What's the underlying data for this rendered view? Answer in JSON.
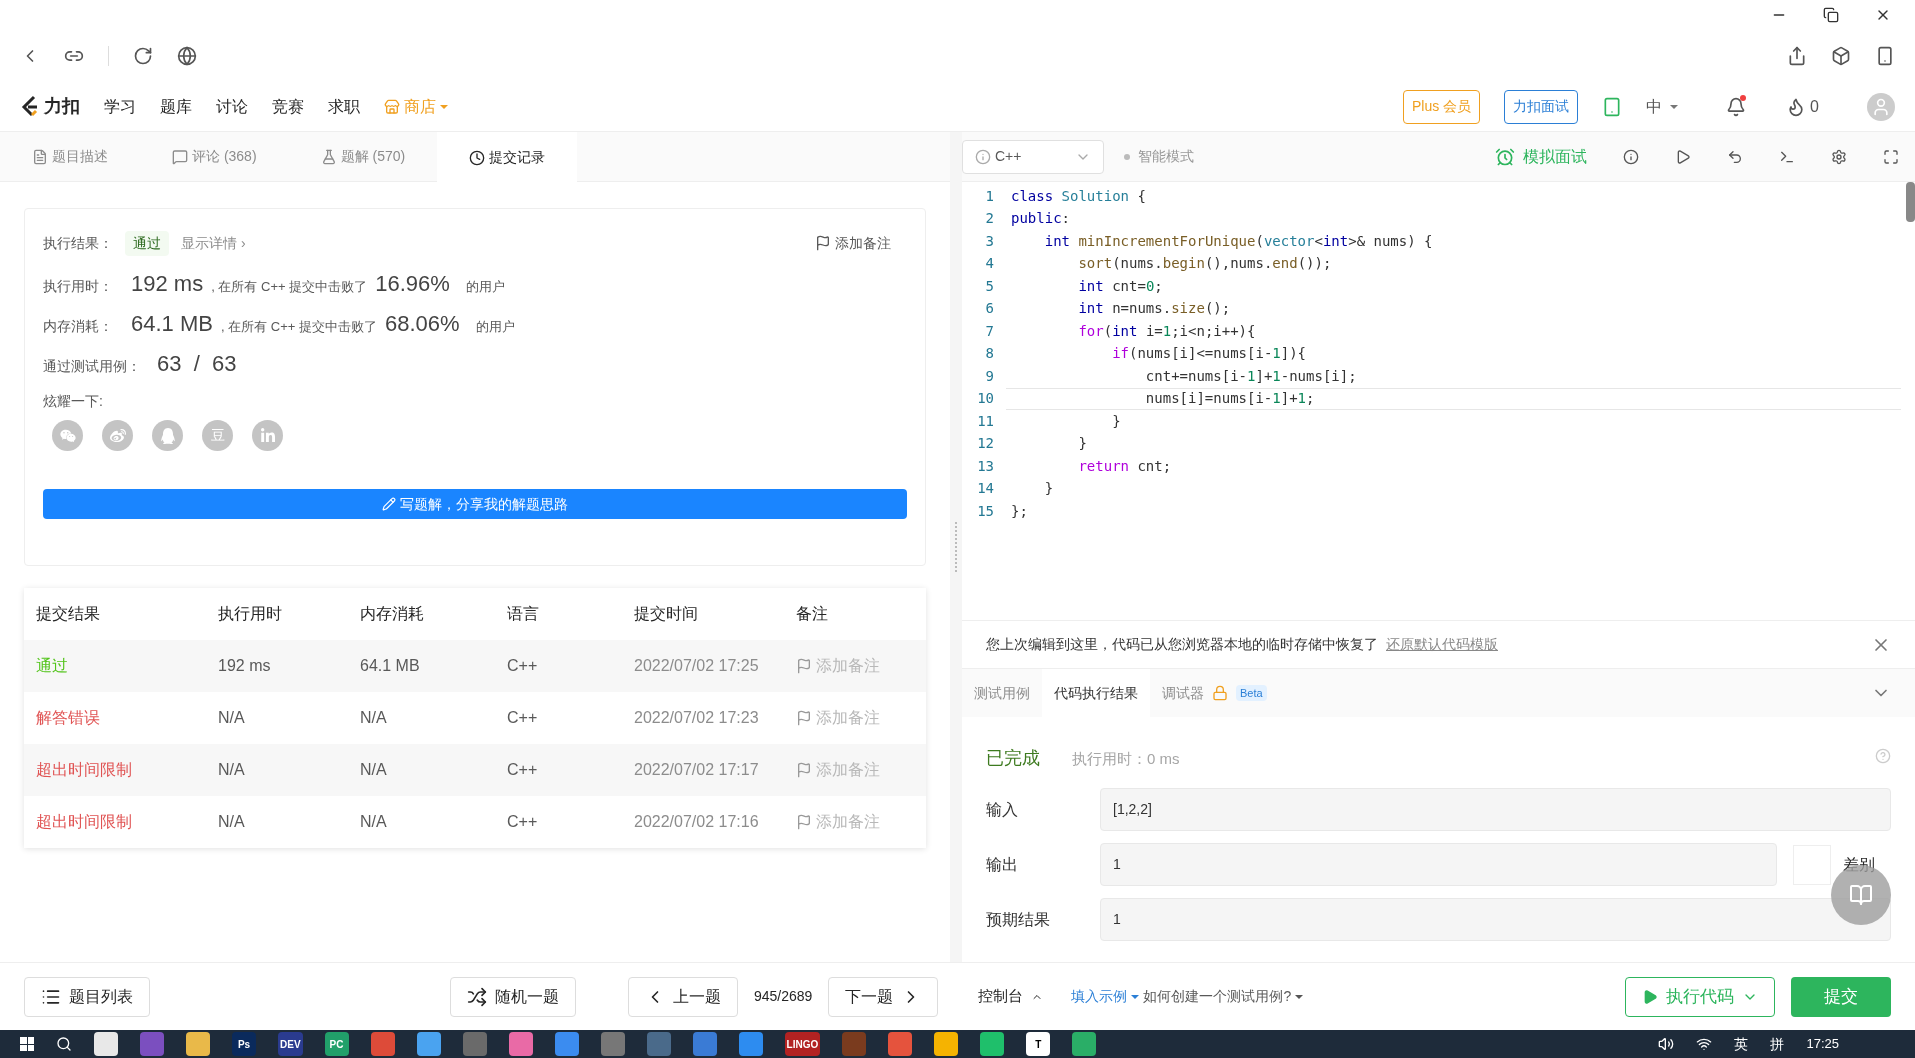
{
  "site_nav": {
    "logo": "力扣",
    "items": [
      "学习",
      "题库",
      "讨论",
      "竞赛",
      "求职"
    ],
    "shop": "商店",
    "plus": "Plus 会员",
    "interview": "力扣面试",
    "language": "中",
    "points": "0"
  },
  "tabs": [
    {
      "label": "题目描述",
      "selected": false
    },
    {
      "label": "评论 (368)",
      "selected": false
    },
    {
      "label": "题解 (570)",
      "selected": false
    },
    {
      "label": "提交记录",
      "selected": true
    }
  ],
  "editor_toolbar": {
    "language": "C++",
    "mode": "智能模式",
    "mock": "模拟面试"
  },
  "result_card": {
    "result_label": "执行结果：",
    "result": "通过",
    "details": "显示详情 ›",
    "note": "添加备注",
    "stats": [
      {
        "label": "执行用时：",
        "value": "192 ms",
        "middle": ", 在所有 C++ 提交中击败了",
        "percent": "16.96%",
        "suffix": "的用户"
      },
      {
        "label": "内存消耗：",
        "value": "64.1 MB",
        "middle": ", 在所有 C++ 提交中击败了",
        "percent": "68.06%",
        "suffix": "的用户"
      }
    ],
    "cases_label": "通过测试用例：",
    "cases": "63  /  63",
    "share_label": "炫耀一下:",
    "share": [
      {
        "kind": "wechat"
      },
      {
        "kind": "weibo"
      },
      {
        "kind": "qq"
      },
      {
        "kind": "douban",
        "text": "豆"
      },
      {
        "kind": "linkedin"
      }
    ],
    "write_button": "写题解，分享我的解题思路"
  },
  "submissions": {
    "columns": [
      "提交结果",
      "执行用时",
      "内存消耗",
      "语言",
      "提交时间",
      "备注"
    ],
    "rows": [
      {
        "status": "通过",
        "color": "#52c41a",
        "time": "192 ms",
        "memory": "64.1 MB",
        "lang": "C++",
        "date": "2022/07/02 17:25",
        "note": "添加备注"
      },
      {
        "status": "解答错误",
        "color": "#e05353",
        "time": "N/A",
        "memory": "N/A",
        "lang": "C++",
        "date": "2022/07/02 17:23",
        "note": "添加备注"
      },
      {
        "status": "超出时间限制",
        "color": "#e05353",
        "time": "N/A",
        "memory": "N/A",
        "lang": "C++",
        "date": "2022/07/02 17:17",
        "note": "添加备注"
      },
      {
        "status": "超出时间限制",
        "color": "#e05353",
        "time": "N/A",
        "memory": "N/A",
        "lang": "C++",
        "date": "2022/07/02 17:16",
        "note": "添加备注"
      }
    ]
  },
  "code": [
    {
      "number": "1",
      "current": false,
      "tokens": [
        {
          "kind": "kw",
          "text": "class"
        },
        {
          "kind": "type",
          "text": " Solution"
        },
        {
          "kind": "plain",
          "text": " {"
        }
      ]
    },
    {
      "number": "2",
      "current": false,
      "tokens": [
        {
          "kind": "kw",
          "text": "public"
        },
        {
          "kind": "plain",
          "text": ":"
        }
      ]
    },
    {
      "number": "3",
      "current": false,
      "tokens": [
        {
          "kind": "kw",
          "text": "    int"
        },
        {
          "kind": "fn",
          "text": " minIncrementForUnique"
        },
        {
          "kind": "plain",
          "text": "("
        },
        {
          "kind": "type",
          "text": "vector"
        },
        {
          "kind": "plain",
          "text": "<"
        },
        {
          "kind": "kw",
          "text": "int"
        },
        {
          "kind": "plain",
          "text": ">& nums) {"
        }
      ]
    },
    {
      "number": "4",
      "current": false,
      "tokens": [
        {
          "kind": "fn",
          "text": "        sort"
        },
        {
          "kind": "plain",
          "text": "(nums."
        },
        {
          "kind": "fn",
          "text": "begin"
        },
        {
          "kind": "plain",
          "text": "(),nums."
        },
        {
          "kind": "fn",
          "text": "end"
        },
        {
          "kind": "plain",
          "text": "());"
        }
      ]
    },
    {
      "number": "5",
      "current": false,
      "tokens": [
        {
          "kind": "kw",
          "text": "        int"
        },
        {
          "kind": "plain",
          "text": " cnt="
        },
        {
          "kind": "num",
          "text": "0"
        },
        {
          "kind": "plain",
          "text": ";"
        }
      ]
    },
    {
      "number": "6",
      "current": false,
      "tokens": [
        {
          "kind": "kw",
          "text": "        int"
        },
        {
          "kind": "plain",
          "text": " n=nums."
        },
        {
          "kind": "fn",
          "text": "size"
        },
        {
          "kind": "plain",
          "text": "();"
        }
      ]
    },
    {
      "number": "7",
      "current": false,
      "tokens": [
        {
          "kind": "ctl",
          "text": "        for"
        },
        {
          "kind": "plain",
          "text": "("
        },
        {
          "kind": "kw",
          "text": "int"
        },
        {
          "kind": "plain",
          "text": " i="
        },
        {
          "kind": "num",
          "text": "1"
        },
        {
          "kind": "plain",
          "text": ";i<n;i++){"
        }
      ]
    },
    {
      "number": "8",
      "current": false,
      "tokens": [
        {
          "kind": "ctl",
          "text": "            if"
        },
        {
          "kind": "plain",
          "text": "(nums[i]<=nums[i-"
        },
        {
          "kind": "num",
          "text": "1"
        },
        {
          "kind": "plain",
          "text": "]){"
        }
      ]
    },
    {
      "number": "9",
      "current": false,
      "tokens": [
        {
          "kind": "plain",
          "text": "                cnt+=nums[i-"
        },
        {
          "kind": "num",
          "text": "1"
        },
        {
          "kind": "plain",
          "text": "]+"
        },
        {
          "kind": "num",
          "text": "1"
        },
        {
          "kind": "plain",
          "text": "-nums[i];"
        }
      ]
    },
    {
      "number": "10",
      "current": true,
      "tokens": [
        {
          "kind": "plain",
          "text": "                nums[i]=nums[i-"
        },
        {
          "kind": "num",
          "text": "1"
        },
        {
          "kind": "plain",
          "text": "]+"
        },
        {
          "kind": "num",
          "text": "1"
        },
        {
          "kind": "plain",
          "text": ";"
        }
      ]
    },
    {
      "number": "11",
      "current": false,
      "tokens": [
        {
          "kind": "plain",
          "text": "            }"
        }
      ]
    },
    {
      "number": "12",
      "current": false,
      "tokens": [
        {
          "kind": "plain",
          "text": "        }"
        }
      ]
    },
    {
      "number": "13",
      "current": false,
      "tokens": [
        {
          "kind": "ctl",
          "text": "        return"
        },
        {
          "kind": "plain",
          "text": " cnt;"
        }
      ]
    },
    {
      "number": "14",
      "current": false,
      "tokens": [
        {
          "kind": "plain",
          "text": "    }"
        }
      ]
    },
    {
      "number": "15",
      "current": false,
      "tokens": [
        {
          "kind": "plain",
          "text": "};"
        }
      ]
    }
  ],
  "restore_notice": {
    "text": "您上次编辑到这里，代码已从您浏览器本地的临时存储中恢复了",
    "link": "还原默认代码模版"
  },
  "console_tabs": [
    {
      "label": "测试用例",
      "selected": false
    },
    {
      "label": "代码执行结果",
      "selected": true
    },
    {
      "label": "调试器",
      "selected": false,
      "badge": "Beta"
    }
  ],
  "run_result": {
    "status": "已完成",
    "runtime": "执行用时：0 ms",
    "fields": [
      {
        "label": "输入",
        "value": "[1,2,2]"
      },
      {
        "label": "输出",
        "value": "1",
        "diff": "差别"
      },
      {
        "label": "预期结果",
        "value": "1"
      }
    ]
  },
  "footer": {
    "problem_list": "题目列表",
    "random": "随机一题",
    "prev": "上一题",
    "progress": "945/2689",
    "next": "下一题",
    "console": "控制台",
    "fill_example": "填入示例",
    "how_to": "如何创建一个测试用例?",
    "run": "执行代码",
    "submit": "提交"
  },
  "taskbar": {
    "apps": [
      {
        "color": "#e8e8e8"
      },
      {
        "color": "#7b4fbf"
      },
      {
        "color": "#e9b949"
      },
      {
        "color": "#0a2a5c",
        "label": "Ps"
      },
      {
        "color": "#2a3b8f",
        "label": "DEV"
      },
      {
        "color": "#21a06a",
        "label": "PC"
      },
      {
        "color": "#dd4b39"
      },
      {
        "color": "#4aa3f0"
      },
      {
        "color": "#6a6a6a"
      },
      {
        "color": "#e96aa6"
      },
      {
        "color": "#3b8cf0"
      },
      {
        "color": "#777777"
      },
      {
        "color": "#4a6a8a"
      },
      {
        "color": "#3a7bd5"
      },
      {
        "color": "#2d8cf0"
      },
      {
        "color": "#b22222",
        "label": "LINGO"
      },
      {
        "color": "#7a3b1e"
      },
      {
        "color": "#e5533d"
      },
      {
        "color": "#f5b301"
      },
      {
        "color": "#1fbf6b"
      },
      {
        "color": "#ffffff",
        "label": "T"
      },
      {
        "color": "#2aae67"
      }
    ],
    "ime": "英",
    "ime2": "拼",
    "clock": "17:25"
  }
}
